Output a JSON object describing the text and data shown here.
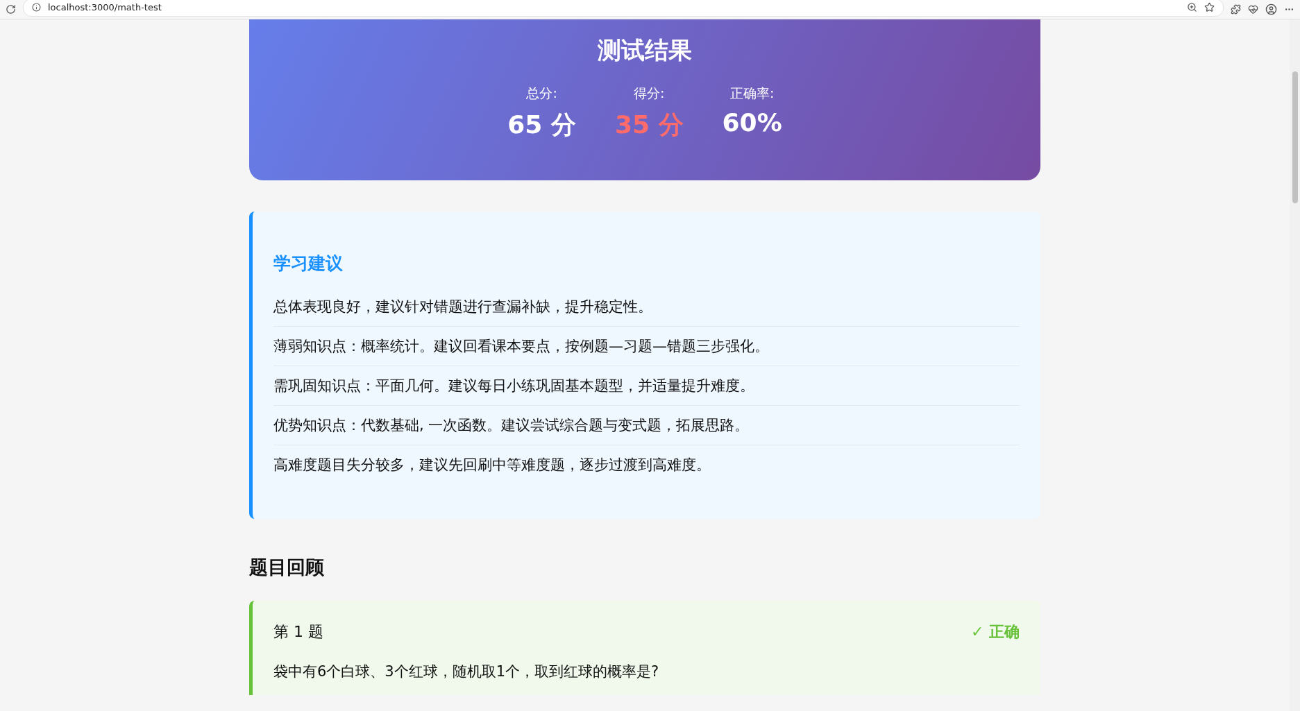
{
  "browser": {
    "url": "localhost:3000/math-test"
  },
  "result": {
    "title": "测试结果",
    "stats": [
      {
        "label": "总分:",
        "value": "65 分",
        "kind": "normal"
      },
      {
        "label": "得分:",
        "value": "35 分",
        "kind": "highlight"
      },
      {
        "label": "正确率:",
        "value": "60%",
        "kind": "normal"
      }
    ]
  },
  "advice": {
    "title": "学习建议",
    "items": [
      "总体表现良好，建议针对错题进行查漏补缺，提升稳定性。",
      "薄弱知识点：概率统计。建议回看课本要点，按例题—习题—错题三步强化。",
      "需巩固知识点：平面几何。建议每日小练巩固基本题型，并适量提升难度。",
      "优势知识点：代数基础, 一次函数。建议尝试综合题与变式题，拓展思路。",
      "高难度题目失分较多，建议先回刷中等难度题，逐步过渡到高难度。"
    ]
  },
  "review": {
    "title": "题目回顾",
    "questions": [
      {
        "number": "第 1 题",
        "correct": true,
        "status": "✓ 正确",
        "text": "袋中有6个白球、3个红球，随机取1个，取到红球的概率是?"
      }
    ]
  }
}
